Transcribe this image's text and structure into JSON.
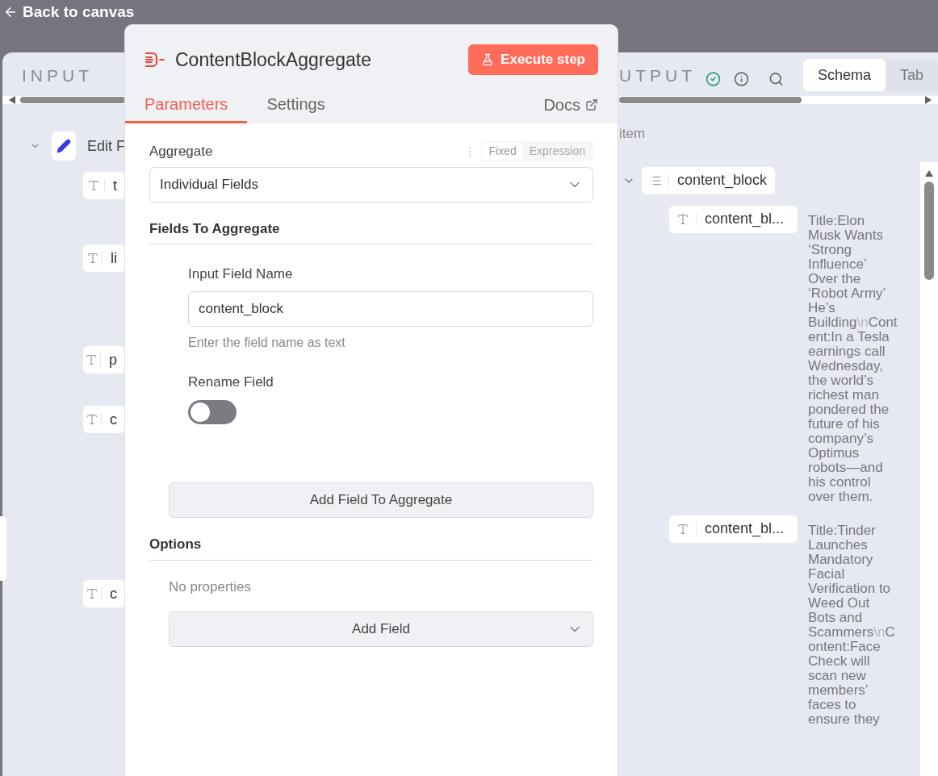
{
  "top_bar": {
    "back_label": "Back to canvas"
  },
  "input_panel": {
    "title": "INPUT",
    "node": {
      "label": "Edit F",
      "expanded": true
    },
    "fields": [
      {
        "label": "t"
      },
      {
        "label": "li"
      },
      {
        "label": "p"
      },
      {
        "label": "c"
      },
      {
        "label": "c"
      }
    ]
  },
  "output_panel": {
    "title": "UTPUT",
    "tabs": [
      {
        "label": "Schema",
        "selected": true
      },
      {
        "label": "Tab",
        "selected": false
      }
    ],
    "item_count": "item",
    "root_field": {
      "label": "content_block",
      "expanded": true,
      "children": [
        {
          "label": "content_bl...",
          "value": [
            {
              "kind": "text",
              "text": "Title:Elon Musk Wants ‘Strong Influence’ Over the ‘Robot Army’ He’s Building"
            },
            {
              "kind": "escape",
              "text": "\\n"
            },
            {
              "kind": "text",
              "text": "Content:In a Tesla earnings call Wednesday, the world’s richest man pondered the future of his company’s Optimus robots—and his control over them."
            }
          ]
        },
        {
          "label": "content_bl...",
          "value": [
            {
              "kind": "text",
              "text": "Title:Tinder Launches Mandatory Facial Verification to Weed Out Bots and Scammers"
            },
            {
              "kind": "escape",
              "text": "\\n"
            },
            {
              "kind": "text",
              "text": "Content:Face Check will scan new members’ faces to ensure they"
            }
          ]
        }
      ]
    }
  },
  "dialog": {
    "title": "ContentBlockAggregate",
    "execute_button": "Execute step",
    "tabs": [
      {
        "label": "Parameters",
        "selected": true
      },
      {
        "label": "Settings",
        "selected": false
      }
    ],
    "docs_link": "Docs",
    "aggregate": {
      "label": "Aggregate",
      "modes": [
        {
          "label": "Fixed",
          "selected": true
        },
        {
          "label": "Expression",
          "selected": false
        }
      ],
      "value": "Individual Fields"
    },
    "fields_section": {
      "heading": "Fields To Aggregate",
      "field_label": "Input Field Name",
      "field_value": "content_block",
      "hint": "Enter the field name as text",
      "rename_label": "Rename Field",
      "rename_on": false
    },
    "add_button": "Add Field To Aggregate",
    "options": {
      "heading": "Options",
      "empty_text": "No properties",
      "add_field": "Add Field"
    }
  }
}
